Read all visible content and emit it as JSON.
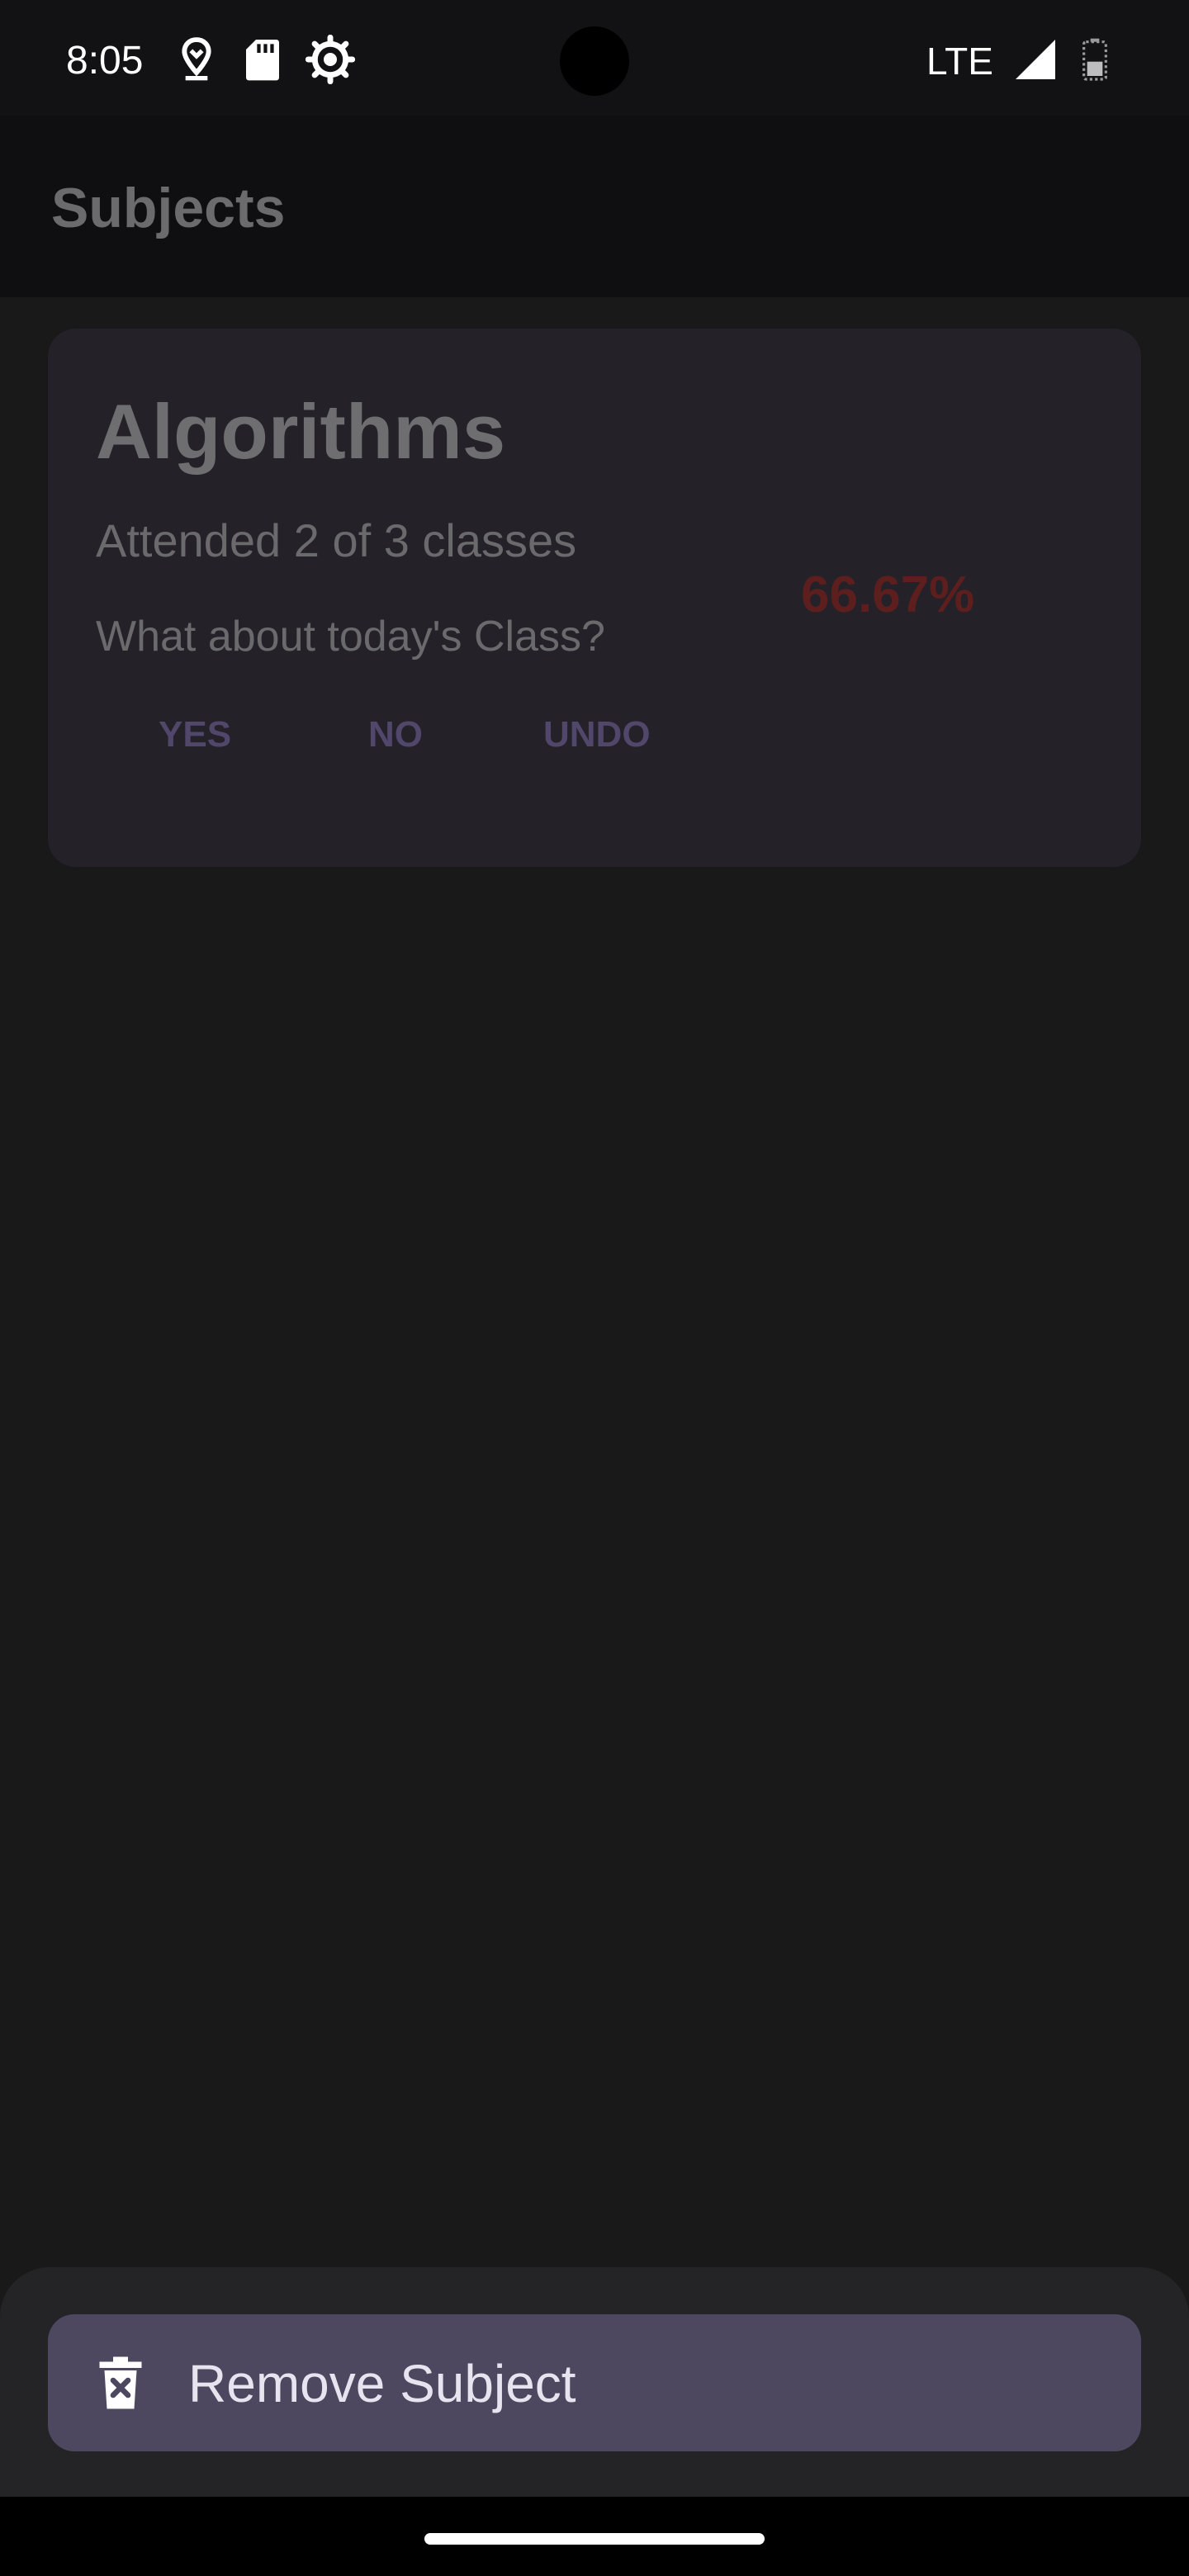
{
  "status_bar": {
    "time": "8:05",
    "network": "LTE",
    "icons": [
      "location-pin-icon",
      "sd-card-icon",
      "settings-gear-icon",
      "signal-icon",
      "battery-icon"
    ]
  },
  "app_bar": {
    "title": "Subjects"
  },
  "subject_card": {
    "name": "Algorithms",
    "attendance": "Attended 2 of 3 classes",
    "question": "What about today's Class?",
    "percentage": "66.67%",
    "buttons": {
      "yes": "YES",
      "no": "NO",
      "undo": "UNDO"
    }
  },
  "bottom_sheet": {
    "remove_label": "Remove Subject",
    "icon": "delete-icon"
  },
  "colors": {
    "background": "#191919",
    "card": "#242129",
    "percentage": "#5d1e1e",
    "button_text": "#51476a",
    "sheet_item": "#4e4760"
  }
}
